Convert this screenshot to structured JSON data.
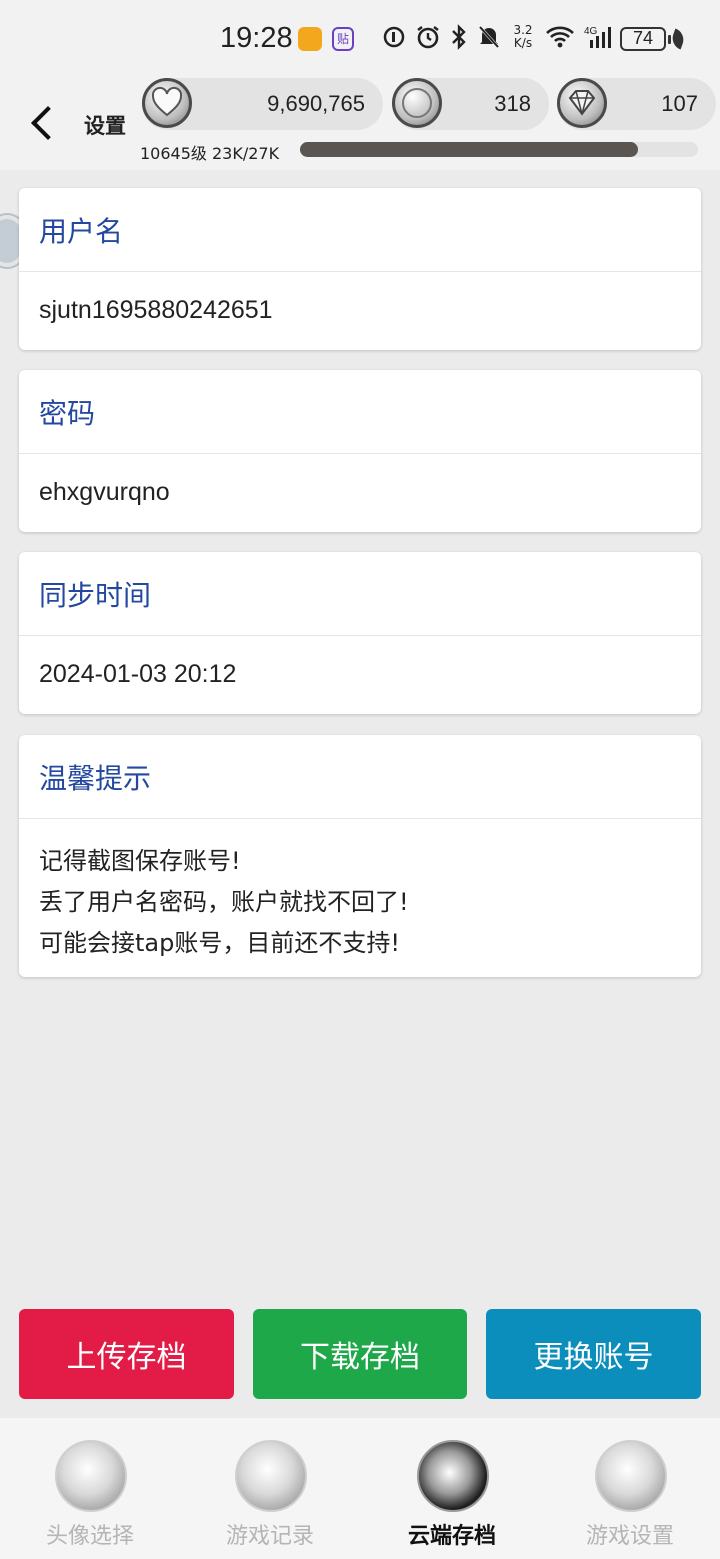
{
  "status_bar": {
    "time": "19:28",
    "app_badge": "贴",
    "net_speed_value": "3.2",
    "net_speed_unit": "K/s",
    "signal_label": "4G",
    "battery": "74"
  },
  "header": {
    "back_icon": "chevron-left-icon",
    "title": "设置",
    "stats": [
      {
        "icon": "heart-coin-icon",
        "value": "9,690,765"
      },
      {
        "icon": "silver-coin-icon",
        "value": "318"
      },
      {
        "icon": "diamond-coin-icon",
        "value": "107"
      }
    ],
    "level_text": "10645级 23K/27K",
    "xp_progress": 0.85
  },
  "cards": {
    "username": {
      "title": "用户名",
      "value": "sjutn1695880242651"
    },
    "password": {
      "title": "密码",
      "value": "ehxgvurqno"
    },
    "sync_time": {
      "title": "同步时间",
      "value": "2024-01-03 20:12"
    },
    "tips": {
      "title": "温馨提示",
      "lines": [
        "记得截图保存账号!",
        "丢了用户名密码，账户就找不回了!",
        "可能会接tap账号，目前还不支持!"
      ]
    }
  },
  "actions": {
    "upload": {
      "label": "上传存档",
      "color": "#e21c47"
    },
    "download": {
      "label": "下载存档",
      "color": "#1ea84a"
    },
    "switch": {
      "label": "更换账号",
      "color": "#0b8ebc"
    }
  },
  "tabs": [
    {
      "label": "头像选择",
      "icon": "avatar-select-icon",
      "active": false
    },
    {
      "label": "游戏记录",
      "icon": "game-record-icon",
      "active": false
    },
    {
      "label": "云端存档",
      "icon": "cloud-save-icon",
      "active": true
    },
    {
      "label": "游戏设置",
      "icon": "game-settings-icon",
      "active": false
    }
  ]
}
